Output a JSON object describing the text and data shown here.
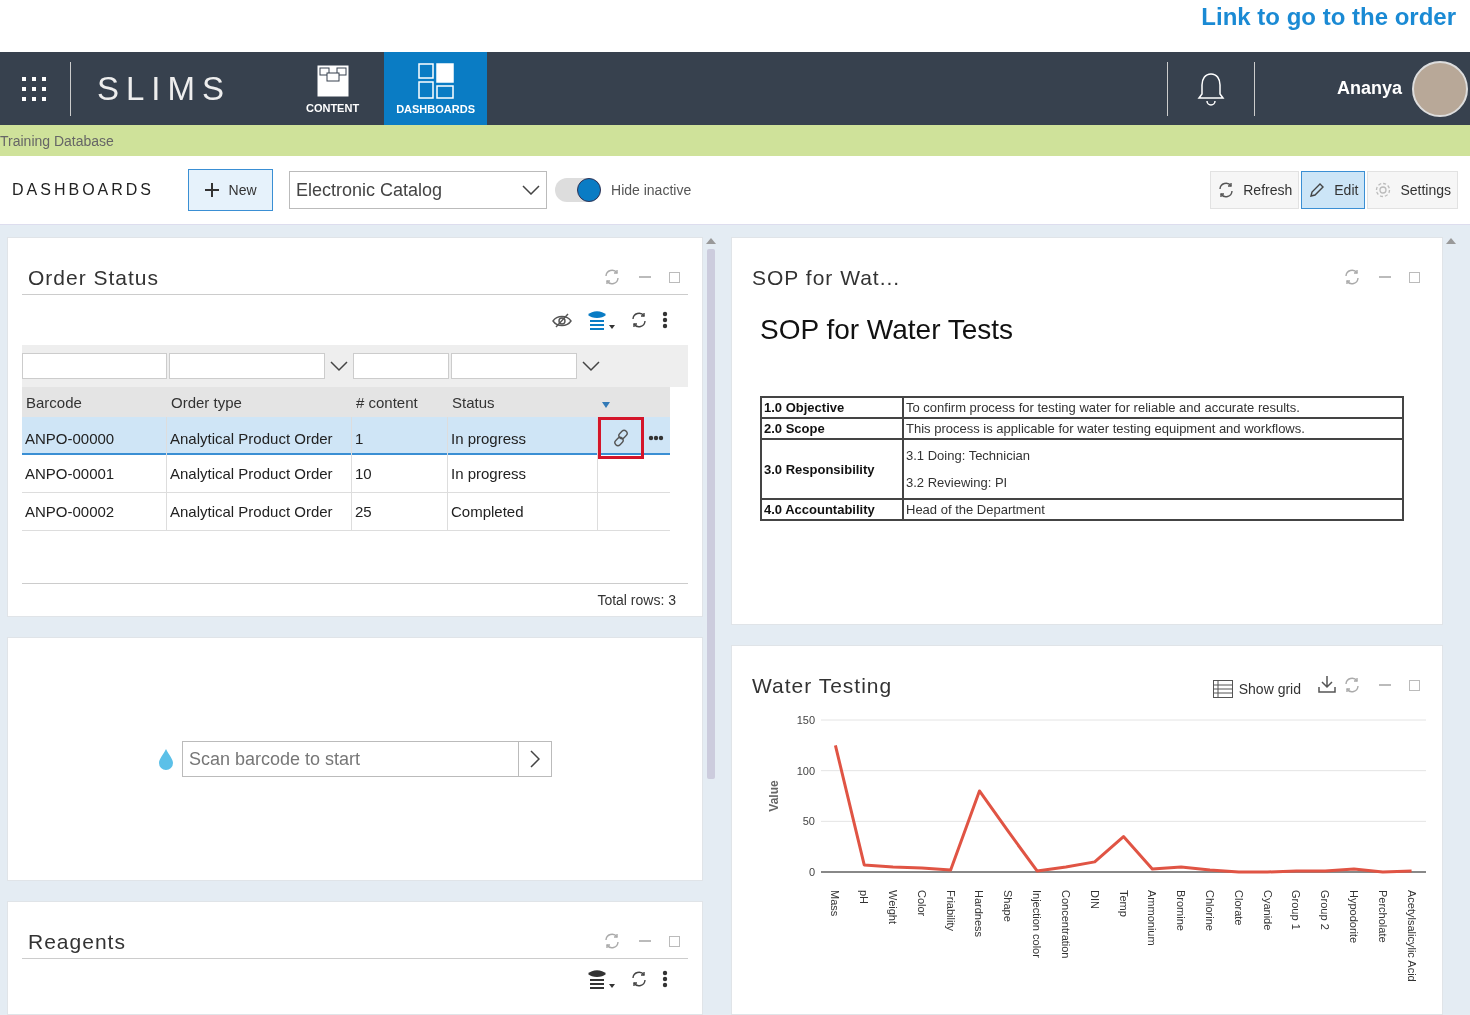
{
  "annotation": {
    "text": "Link to go to the order"
  },
  "nav": {
    "brand": "SLIMS",
    "tabs": [
      {
        "label": "CONTENT",
        "selected": false
      },
      {
        "label": "DASHBOARDS",
        "selected": true
      }
    ],
    "user": "Ananya"
  },
  "database": "Training Database",
  "toolbar": {
    "title": "DASHBOARDS",
    "new_button": "New",
    "dashboard_select": "Electronic Catalog",
    "hide_inactive": {
      "label": "Hide inactive",
      "on": true
    },
    "actions": [
      {
        "label": "Refresh",
        "selected": false
      },
      {
        "label": "Edit",
        "selected": true
      },
      {
        "label": "Settings",
        "selected": false
      }
    ]
  },
  "order_status": {
    "title": "Order Status",
    "columns": [
      "Barcode",
      "Order type",
      "# content",
      "Status"
    ],
    "rows": [
      {
        "cells": [
          "ANPO-00000",
          "Analytical Product Order",
          "1",
          "In progress"
        ],
        "selected": true,
        "link_highlighted": true
      },
      {
        "cells": [
          "ANPO-00001",
          "Analytical Product Order",
          "10",
          "In progress"
        ],
        "selected": false,
        "link_highlighted": false
      },
      {
        "cells": [
          "ANPO-00002",
          "Analytical Product Order",
          "25",
          "Completed"
        ],
        "selected": false,
        "link_highlighted": false
      }
    ],
    "footer": "Total rows: 3"
  },
  "scan": {
    "placeholder": "Scan barcode to start"
  },
  "reagents": {
    "title": "Reagents"
  },
  "sop": {
    "title": "SOP for Wat...",
    "heading": "SOP for Water Tests",
    "rows": [
      {
        "label": "1.0 Objective",
        "lines": [
          "To confirm process for testing water for reliable and accurate results."
        ]
      },
      {
        "label": "2.0 Scope",
        "lines": [
          "This process is applicable for water testing equipment and workflows."
        ]
      },
      {
        "label": "3.0 Responsibility",
        "lines": [
          "3.1 Doing: Technician",
          "3.2 Reviewing: PI"
        ]
      },
      {
        "label": "4.0 Accountability",
        "lines": [
          "Head of the Department"
        ]
      }
    ]
  },
  "water_testing": {
    "title": "Water Testing",
    "show_grid": "Show grid",
    "chart_data": {
      "type": "line",
      "ylabel": "Value",
      "categories": [
        "Mass",
        "pH",
        "Weight",
        "Color",
        "Friability",
        "Hardness",
        "Shape",
        "Injection color",
        "Concentration",
        "DIN",
        "Temp",
        "Ammonium",
        "Bromine",
        "Chlorine",
        "Clorate",
        "Cyanide",
        "Group 1",
        "Group 2",
        "Hypodorite",
        "Percholate",
        "Acetylsalicylic Acid"
      ],
      "series": [
        {
          "color": "#e05444",
          "values": [
            125,
            7,
            5,
            4,
            2,
            80,
            40,
            1,
            5,
            10,
            35,
            3,
            5,
            2,
            0,
            0,
            1,
            1,
            3,
            0,
            1
          ]
        }
      ],
      "ylim": [
        0,
        150
      ],
      "yticks": [
        0,
        50,
        100,
        150
      ]
    }
  }
}
